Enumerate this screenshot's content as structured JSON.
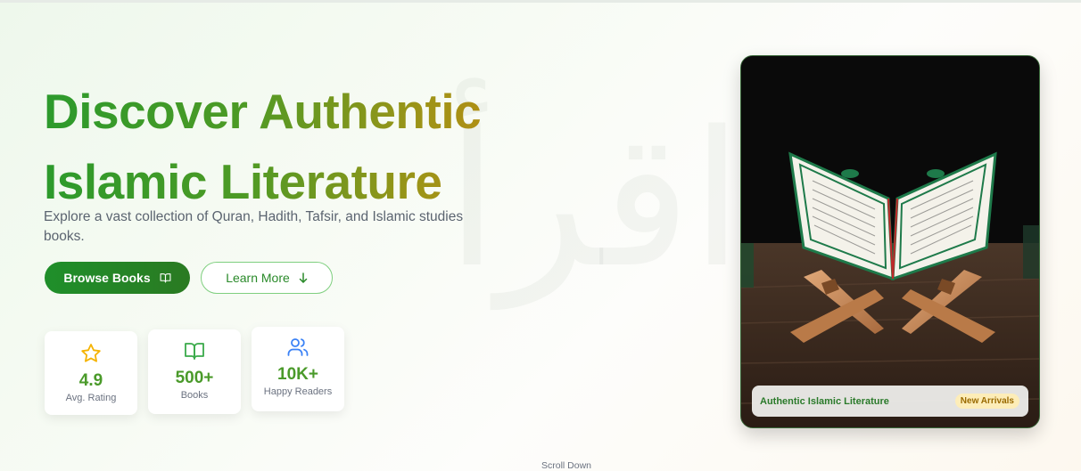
{
  "hero": {
    "headline": "Discover Authentic Islamic Literature",
    "subtitle": "Explore a vast collection of Quran, Hadith, Tafsir, and Islamic studies books.",
    "watermark": "اقرأ"
  },
  "buttons": {
    "browse_label": "Browse Books",
    "browse_icon": "book-open-icon",
    "learn_label": "Learn More",
    "learn_icon": "arrow-down-icon"
  },
  "stats": [
    {
      "icon": "star-icon",
      "value": "4.9",
      "label": "Avg. Rating"
    },
    {
      "icon": "book-open-icon",
      "value": "500+",
      "label": "Books"
    },
    {
      "icon": "users-icon",
      "value": "10K+",
      "label": "Happy Readers"
    }
  ],
  "feature_card": {
    "caption": "Authentic Islamic Literature",
    "badge": "New Arrivals"
  },
  "scroll_hint": "Scroll Down",
  "colors": {
    "primary_green": "#2a8a2a",
    "gold": "#c08a12",
    "star": "#f5b301",
    "users_icon": "#3b82f6"
  }
}
